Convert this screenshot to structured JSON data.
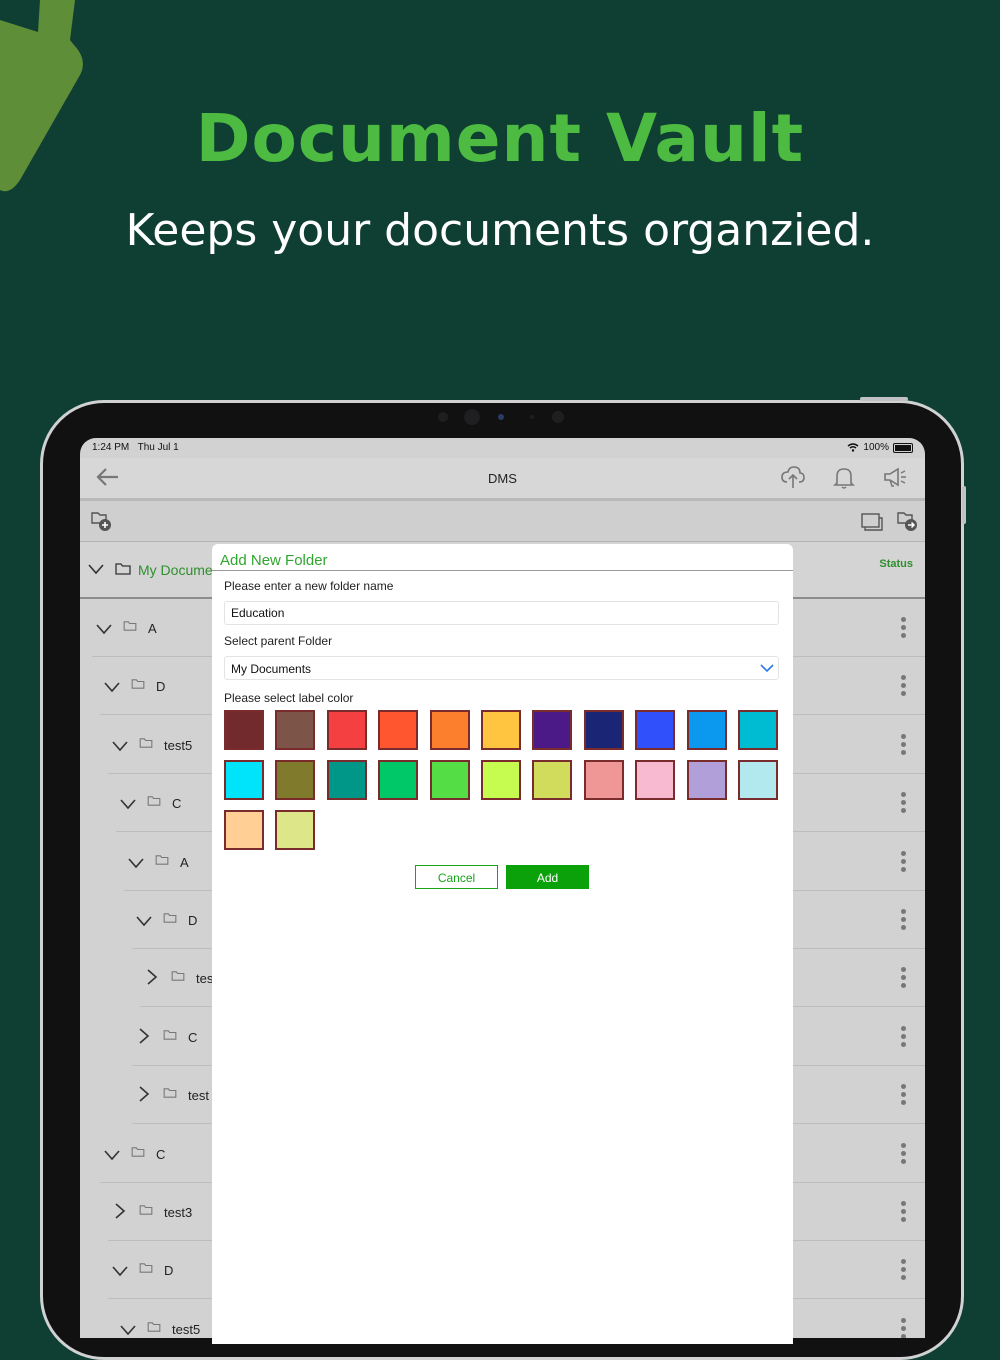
{
  "promo": {
    "title": "Document Vault",
    "subtitle": "Keeps your documents organzied."
  },
  "status_bar": {
    "time": "1:24 PM",
    "date": "Thu Jul 1",
    "battery": "100%"
  },
  "nav": {
    "title": "DMS",
    "icons": [
      "back-arrow-icon",
      "cloud-upload-icon",
      "bell-icon",
      "megaphone-icon"
    ]
  },
  "toolbar": {
    "icons": [
      "add-folder-icon",
      "folders-icon",
      "move-folder-icon"
    ]
  },
  "tree": {
    "root_label": "My Docume",
    "status_label": "Status",
    "rows": [
      {
        "label": "A",
        "expanded": true
      },
      {
        "label": "D",
        "expanded": true
      },
      {
        "label": "test5",
        "expanded": true
      },
      {
        "label": "C",
        "expanded": true
      },
      {
        "label": "A",
        "expanded": true
      },
      {
        "label": "D",
        "expanded": true
      },
      {
        "label": "tes",
        "expanded": false
      },
      {
        "label": "C",
        "expanded": false
      },
      {
        "label": "test",
        "expanded": false
      },
      {
        "label": "C",
        "expanded": true
      },
      {
        "label": "test3",
        "expanded": false
      },
      {
        "label": "D",
        "expanded": true
      },
      {
        "label": "test5",
        "expanded": true
      }
    ]
  },
  "dialog": {
    "title": "Add New Folder",
    "name_prompt": "Please enter a new folder name",
    "name_value": "Education",
    "parent_prompt": "Select parent Folder",
    "parent_value": "My Documents",
    "color_prompt": "Please select label color",
    "colors": [
      "#722a2c",
      "#7d5548",
      "#f44040",
      "#ff5630",
      "#fb7f2c",
      "#ffc540",
      "#4b1a86",
      "#1a2675",
      "#3050fb",
      "#0a99ee",
      "#00bcd3",
      "#00e4fb",
      "#807a2c",
      "#009688",
      "#00c767",
      "#55dd46",
      "#c6fb50",
      "#d2dc5c",
      "#ef9697",
      "#f8bad0",
      "#b09fd8",
      "#b1e9ef",
      "#ffcf95",
      "#dde78a"
    ],
    "cancel_label": "Cancel",
    "add_label": "Add"
  }
}
